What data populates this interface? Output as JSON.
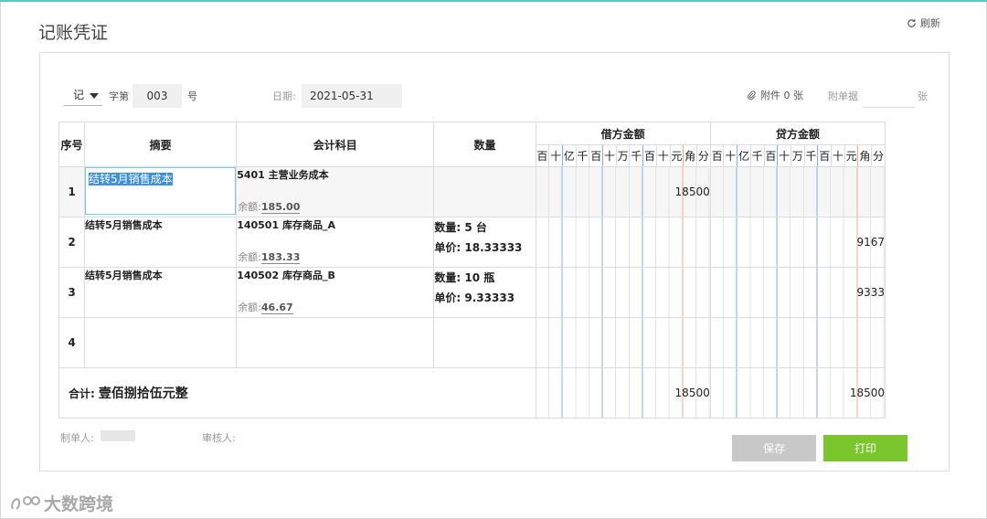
{
  "page": {
    "title": "记账凭证",
    "refresh_label": "刷新"
  },
  "header": {
    "voucher_type": "记",
    "zi_label": "字第",
    "voucher_no": "003",
    "hao_label": "号",
    "date_label": "日期:",
    "date_value": "2021-05-31",
    "attachments_label": "附件 0 张",
    "bills_label": "附单据",
    "bills_unit": "张"
  },
  "table": {
    "headers": {
      "seq": "序号",
      "summary": "摘要",
      "account": "会计科目",
      "quantity": "数量",
      "debit": "借方金额",
      "credit": "贷方金额"
    },
    "digit_headers": [
      "百",
      "十",
      "亿",
      "千",
      "百",
      "十",
      "万",
      "千",
      "百",
      "十",
      "元",
      "角",
      "分"
    ],
    "balance_label": "余额:",
    "rows": [
      {
        "seq": "1",
        "summary": "结转5月销售成本",
        "account": "5401 主营业务成本",
        "balance": "185.00",
        "qty": "",
        "price": "",
        "debit": "18500",
        "credit": ""
      },
      {
        "seq": "2",
        "summary": "结转5月销售成本",
        "account": "140501 库存商品_A",
        "balance": "183.33",
        "qty": "数量: 5 台",
        "price": "单价: 18.33333",
        "debit": "",
        "credit": "9167"
      },
      {
        "seq": "3",
        "summary": "结转5月销售成本",
        "account": "140502 库存商品_B",
        "balance": "46.67",
        "qty": "数量: 10 瓶",
        "price": "单价: 9.33333",
        "debit": "",
        "credit": "9333"
      },
      {
        "seq": "4",
        "summary": "",
        "account": "",
        "balance": "",
        "qty": "",
        "price": "",
        "debit": "",
        "credit": ""
      }
    ],
    "total": {
      "label": "合计:",
      "text": "壹佰捌拾伍元整",
      "debit": "18500",
      "credit": "18500"
    }
  },
  "footer": {
    "maker_label": "制单人:",
    "reviewer_label": "审核人:",
    "save_label": "保存",
    "print_label": "打印"
  },
  "watermark": {
    "text": "大数跨境"
  },
  "colors": {
    "accent": "#5ec8c4",
    "print_button": "#7ac72d",
    "save_button": "#c8c8c8",
    "selection": "#3d8fe0",
    "yuan_line": "#7fb4de",
    "jiao_line": "#f0a3a3"
  }
}
